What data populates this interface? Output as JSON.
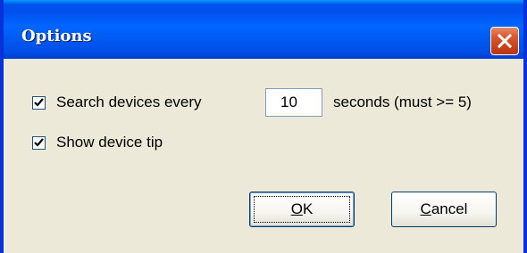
{
  "window": {
    "title": "Options",
    "close_icon": "close-icon"
  },
  "options": {
    "search_devices": {
      "checked": true,
      "label_before": "Search devices every",
      "interval_value": "10",
      "label_after": "seconds (must >= 5)"
    },
    "show_tip": {
      "checked": true,
      "label": "Show device tip"
    }
  },
  "buttons": {
    "ok": {
      "mnemonic": "O",
      "rest": "K"
    },
    "cancel": {
      "mnemonic": "C",
      "rest": "ancel"
    }
  },
  "colors": {
    "titlebar": "#0058f0",
    "frame": "#0831d9",
    "dialog_bg": "#ece9d8",
    "close_button": "#d8582e",
    "checkmark": "#21a121"
  }
}
